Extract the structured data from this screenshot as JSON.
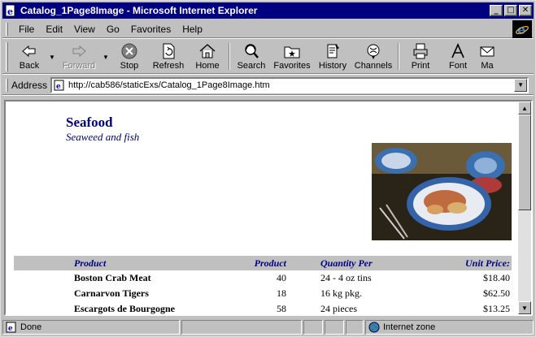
{
  "window": {
    "title": "Catalog_1Page8Image - Microsoft Internet Explorer"
  },
  "menu": [
    "File",
    "Edit",
    "View",
    "Go",
    "Favorites",
    "Help"
  ],
  "toolbar": {
    "back": "Back",
    "forward": "Forward",
    "stop": "Stop",
    "refresh": "Refresh",
    "home": "Home",
    "search": "Search",
    "favorites": "Favorites",
    "history": "History",
    "channels": "Channels",
    "print": "Print",
    "font": "Font",
    "mail": "Ma"
  },
  "address": {
    "label": "Address",
    "url": "http://cab586/staticExs/Catalog_1Page8Image.htm"
  },
  "page": {
    "category": "Seafood",
    "description": "Seaweed and fish",
    "columns": [
      "Product",
      "Product",
      "Quantity Per",
      "Unit Price:"
    ],
    "rows": [
      {
        "name": "Boston Crab Meat",
        "id": "40",
        "qty": "24 - 4 oz tins",
        "price": "$18.40"
      },
      {
        "name": "Carnarvon Tigers",
        "id": "18",
        "qty": "16 kg pkg.",
        "price": "$62.50"
      },
      {
        "name": "Escargots de Bourgogne",
        "id": "58",
        "qty": "24 pieces",
        "price": "$13.25"
      }
    ]
  },
  "status": {
    "text": "Done",
    "zone": "Internet zone"
  },
  "icons": [
    "ie-page-icon",
    "back-arrow-icon",
    "forward-arrow-icon",
    "stop-icon",
    "refresh-icon",
    "home-icon",
    "search-icon",
    "favorites-icon",
    "history-icon",
    "channels-icon",
    "print-icon",
    "font-icon",
    "ie-logo-icon",
    "globe-icon"
  ]
}
